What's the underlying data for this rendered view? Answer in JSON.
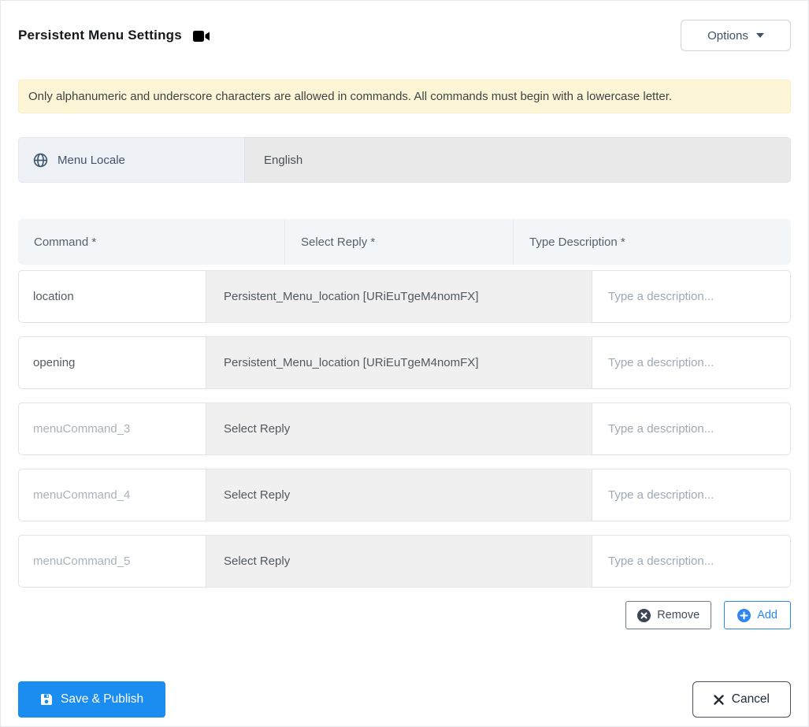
{
  "header": {
    "title": "Persistent Menu Settings",
    "options_label": "Options"
  },
  "alert": {
    "text": "Only alphanumeric and underscore characters are allowed in commands. All commands must begin with a lowercase letter."
  },
  "locale": {
    "label": "Menu Locale",
    "value": "English"
  },
  "table": {
    "headers": [
      "Command *",
      "Select Reply *",
      "Type Description *"
    ],
    "description_placeholder": "Type a description...",
    "rows": [
      {
        "command": "location",
        "command_state": "value",
        "reply": "Persistent_Menu_location [URiEuTgeM4nomFX]",
        "reply_state": "selected"
      },
      {
        "command": "opening",
        "command_state": "value",
        "reply": "Persistent_Menu_location [URiEuTgeM4nomFX]",
        "reply_state": "selected"
      },
      {
        "command": "menuCommand_3",
        "command_state": "placeholder",
        "reply": "Select Reply",
        "reply_state": "empty"
      },
      {
        "command": "menuCommand_4",
        "command_state": "placeholder",
        "reply": "Select Reply",
        "reply_state": "empty"
      },
      {
        "command": "menuCommand_5",
        "command_state": "placeholder",
        "reply": "Select Reply",
        "reply_state": "empty"
      }
    ]
  },
  "actions": {
    "remove_label": "Remove",
    "add_label": "Add"
  },
  "footer": {
    "save_label": "Save & Publish",
    "cancel_label": "Cancel"
  },
  "icons": {
    "title_icon": "video-camera-icon",
    "locale_icon": "globe-icon",
    "options_icon": "caret-down-icon",
    "remove_icon": "circle-x-icon",
    "add_icon": "circle-plus-icon",
    "save_icon": "floppy-disk-icon",
    "cancel_icon": "x-icon"
  },
  "colors": {
    "accent_blue": "#1b8cf0",
    "add_blue": "#2e86f0",
    "alert_bg": "#fdf6d6",
    "table_header_bg": "#f3f6f9",
    "locale_addon_bg": "#eef1f6",
    "disabled_input_bg": "#e9e9e9",
    "reply_field_bg": "#f0f0f0",
    "dark_text": "#16181b",
    "muted_text": "#57616c",
    "placeholder_text": "#a9b2bc"
  }
}
